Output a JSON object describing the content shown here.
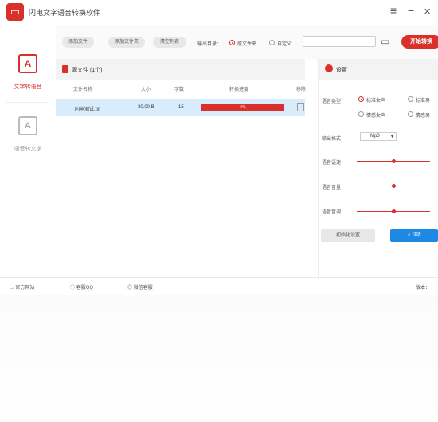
{
  "app": {
    "title": "闪电文字语音转换软件"
  },
  "window": {
    "menu_glyph": "≡",
    "minimize_glyph": "−",
    "close_glyph": "✕"
  },
  "sidebar": {
    "items": [
      {
        "label": "文字转语音",
        "icon": "text-to-speech-icon",
        "active": true
      },
      {
        "label": "语音转文字",
        "icon": "speech-to-text-icon",
        "active": false
      }
    ]
  },
  "toolbar": {
    "add_file": "添加文件",
    "add_folder": "添加文件夹",
    "clear_list": "清空列表",
    "output_dir_label": "输出目录：",
    "output_options": [
      {
        "label": "原文件夹",
        "selected": true
      },
      {
        "label": "自定义",
        "selected": false
      }
    ],
    "path_value": "",
    "start_button": "开始转换"
  },
  "file_panel": {
    "title": "源文件 (1个)",
    "columns": [
      "文件名称",
      "大小",
      "字数",
      "转换进度",
      "移除"
    ],
    "rows": [
      {
        "name": "闪电测试.txt",
        "size": "30.00 B",
        "words": "15",
        "progress_text": "0%",
        "progress": 1.0
      }
    ]
  },
  "settings": {
    "title": "设置",
    "voice_type_label": "语音类型：",
    "voice_options": [
      {
        "label": "标准女声",
        "selected": true
      },
      {
        "label": "标准男",
        "selected": false
      },
      {
        "label": "情感女声",
        "selected": false
      },
      {
        "label": "情感男",
        "selected": false
      }
    ],
    "format_label": "输出格式：",
    "format_value": "Mp3",
    "speed_label": "语音语速：",
    "volume_label": "语音音量：",
    "pitch_label": "语音音调：",
    "speed": 0.5,
    "volume": 0.5,
    "pitch": 0.5,
    "reset_button": "初始化设置",
    "listen_button": "试听"
  },
  "status_bar": {
    "website": "官方网站",
    "qq": "客服QQ",
    "wechat": "微信客服",
    "version": "版本："
  },
  "colors": {
    "accent": "#d9302b",
    "listen_blue": "#1e88e5",
    "row_highlight": "#d9ecfb"
  }
}
